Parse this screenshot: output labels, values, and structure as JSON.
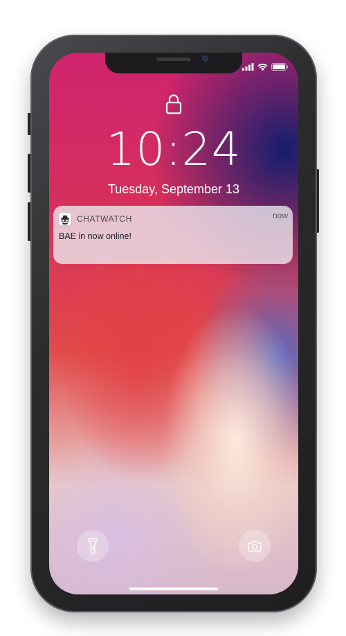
{
  "status_bar": {
    "signal_icon": "cellular-signal-icon",
    "wifi_icon": "wifi-icon",
    "battery_icon": "battery-icon"
  },
  "lock_screen": {
    "lock_icon": "lock-icon",
    "time": "10:24",
    "date": "Tuesday, September 13"
  },
  "notification": {
    "app_icon": "spy-icon",
    "app_name": "CHATWATCH",
    "time": "now",
    "message": "BAE in now online!"
  },
  "quick_actions": {
    "flashlight_icon": "flashlight-icon",
    "camera_icon": "camera-icon"
  }
}
